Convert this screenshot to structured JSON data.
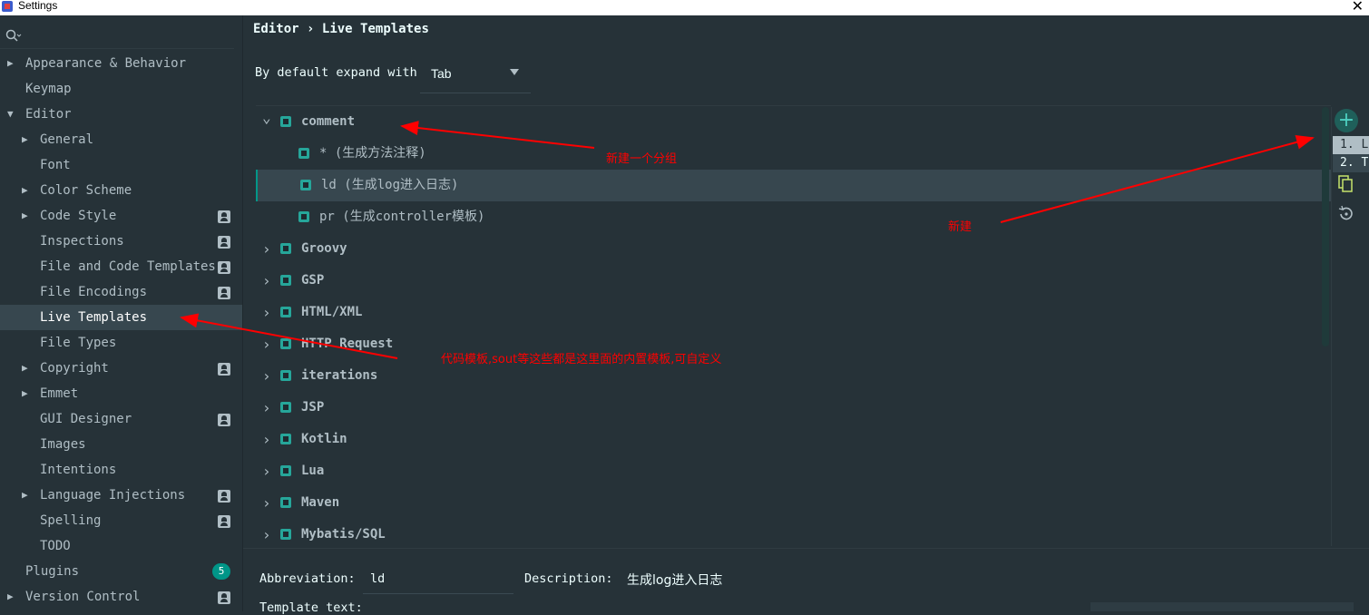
{
  "window": {
    "title": "Settings"
  },
  "sidebar": {
    "items": [
      {
        "label": "Appearance & Behavior",
        "level": 0,
        "arrow": "▶",
        "icon": false
      },
      {
        "label": "Keymap",
        "level": 0,
        "arrow": "",
        "icon": false
      },
      {
        "label": "Editor",
        "level": 0,
        "arrow": "▼",
        "icon": false
      },
      {
        "label": "General",
        "level": 1,
        "arrow": "▶",
        "icon": false
      },
      {
        "label": "Font",
        "level": 1,
        "arrow": "",
        "icon": false
      },
      {
        "label": "Color Scheme",
        "level": 1,
        "arrow": "▶",
        "icon": false
      },
      {
        "label": "Code Style",
        "level": 1,
        "arrow": "▶",
        "icon": true
      },
      {
        "label": "Inspections",
        "level": 1,
        "arrow": "",
        "icon": true
      },
      {
        "label": "File and Code Templates",
        "level": 1,
        "arrow": "",
        "icon": true
      },
      {
        "label": "File Encodings",
        "level": 1,
        "arrow": "",
        "icon": true
      },
      {
        "label": "Live Templates",
        "level": 1,
        "arrow": "",
        "icon": false,
        "selected": true
      },
      {
        "label": "File Types",
        "level": 1,
        "arrow": "",
        "icon": false
      },
      {
        "label": "Copyright",
        "level": 1,
        "arrow": "▶",
        "icon": true
      },
      {
        "label": "Emmet",
        "level": 1,
        "arrow": "▶",
        "icon": false
      },
      {
        "label": "GUI Designer",
        "level": 1,
        "arrow": "",
        "icon": true
      },
      {
        "label": "Images",
        "level": 1,
        "arrow": "",
        "icon": false
      },
      {
        "label": "Intentions",
        "level": 1,
        "arrow": "",
        "icon": false
      },
      {
        "label": "Language Injections",
        "level": 1,
        "arrow": "▶",
        "icon": true
      },
      {
        "label": "Spelling",
        "level": 1,
        "arrow": "",
        "icon": true
      },
      {
        "label": "TODO",
        "level": 1,
        "arrow": "",
        "icon": false
      },
      {
        "label": "Plugins",
        "level": 0,
        "arrow": "",
        "icon": false,
        "badge": "5"
      },
      {
        "label": "Version Control",
        "level": 0,
        "arrow": "▶",
        "icon": true
      }
    ]
  },
  "breadcrumb": {
    "parent": "Editor",
    "separator": "›",
    "current": "Live Templates"
  },
  "expand": {
    "label": "By default expand with",
    "value": "Tab"
  },
  "tree": {
    "rows": [
      {
        "text": "comment",
        "kind": "group",
        "expanded": true
      },
      {
        "text": "* (生成方法注释)",
        "kind": "template"
      },
      {
        "text": "ld (生成log进入日志)",
        "kind": "template",
        "selected": true
      },
      {
        "text": "pr (生成controller模板)",
        "kind": "template"
      },
      {
        "text": "Groovy",
        "kind": "group"
      },
      {
        "text": "GSP",
        "kind": "group"
      },
      {
        "text": "HTML/XML",
        "kind": "group"
      },
      {
        "text": "HTTP Request",
        "kind": "group"
      },
      {
        "text": "iterations",
        "kind": "group"
      },
      {
        "text": "JSP",
        "kind": "group"
      },
      {
        "text": "Kotlin",
        "kind": "group"
      },
      {
        "text": "Lua",
        "kind": "group"
      },
      {
        "text": "Maven",
        "kind": "group"
      },
      {
        "text": "Mybatis/SQL",
        "kind": "group"
      }
    ]
  },
  "toolbar": {
    "add_symbol": "+",
    "add_menu": [
      "1. L",
      "2. T"
    ],
    "icons": [
      "add-icon",
      "copy-icon",
      "restore-icon"
    ]
  },
  "detail": {
    "abbreviation_label": "Abbreviation:",
    "abbreviation_value": "ld",
    "description_label": "Description:",
    "description_value": "生成log进入日志",
    "template_text_label": "Template text:"
  },
  "annotations": {
    "new_group": "新建一个分组",
    "new": "新建",
    "live_templates_note": "代码模板,sout等这些都是这里面的内置模板,可自定义"
  },
  "colors": {
    "background": "#263238",
    "selection": "#37474F",
    "accent": "#009688",
    "text": "#B0BEC5",
    "annotation": "#ff0000"
  }
}
